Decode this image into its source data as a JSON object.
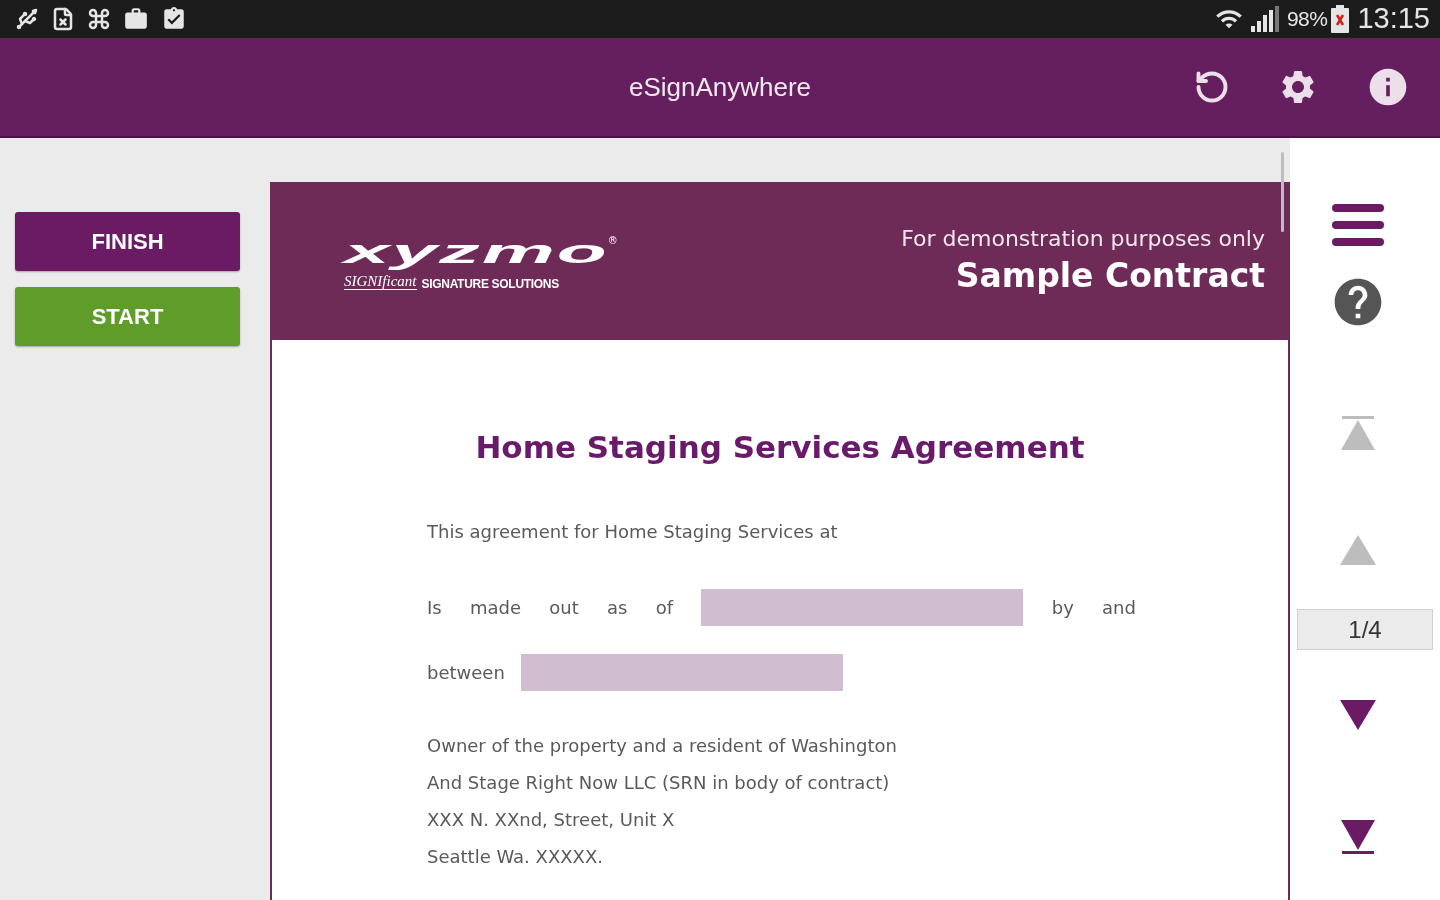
{
  "status_bar": {
    "battery": "98%",
    "time": "13:15"
  },
  "app_bar": {
    "title": "eSignAnywhere"
  },
  "actions": [
    {
      "label": "FINISH",
      "kind": "finish"
    },
    {
      "label": "START",
      "kind": "start"
    }
  ],
  "document": {
    "logo": {
      "wordmark": "xyzmo",
      "mark": "®",
      "script": "SIGNIficant",
      "tagline": "SIGNATURE SOLUTIONS"
    },
    "notice": "For demonstration purposes only",
    "header_title": "Sample Contract",
    "title": "Home Staging Services Agreement",
    "body": [
      {
        "kind": "paragraph",
        "text": "This agreement for Home Staging Services at"
      },
      {
        "kind": "justified_row",
        "parts": [
          {
            "kind": "word",
            "text": "Is"
          },
          {
            "kind": "word",
            "text": "made"
          },
          {
            "kind": "word",
            "text": "out"
          },
          {
            "kind": "word",
            "text": "as"
          },
          {
            "kind": "word",
            "text": "of"
          },
          {
            "kind": "field"
          },
          {
            "kind": "word",
            "text": "by"
          },
          {
            "kind": "word",
            "text": "and"
          }
        ]
      },
      {
        "kind": "row",
        "parts": [
          {
            "kind": "word",
            "text": "between"
          },
          {
            "kind": "field"
          }
        ]
      },
      {
        "kind": "lines",
        "lines": [
          "Owner of the property and a resident of Washington",
          "And Stage Right Now LLC (SRN in body of contract)",
          "XXX N. XXnd, Street, Unit X",
          "Seattle Wa. XXXXX."
        ]
      }
    ]
  },
  "page_nav": {
    "items": [
      {
        "kind": "first",
        "disabled": true
      },
      {
        "kind": "previous",
        "disabled": true
      },
      {
        "kind": "indicator",
        "text": "1/4"
      },
      {
        "kind": "next",
        "disabled": false
      },
      {
        "kind": "last",
        "disabled": false
      }
    ]
  }
}
